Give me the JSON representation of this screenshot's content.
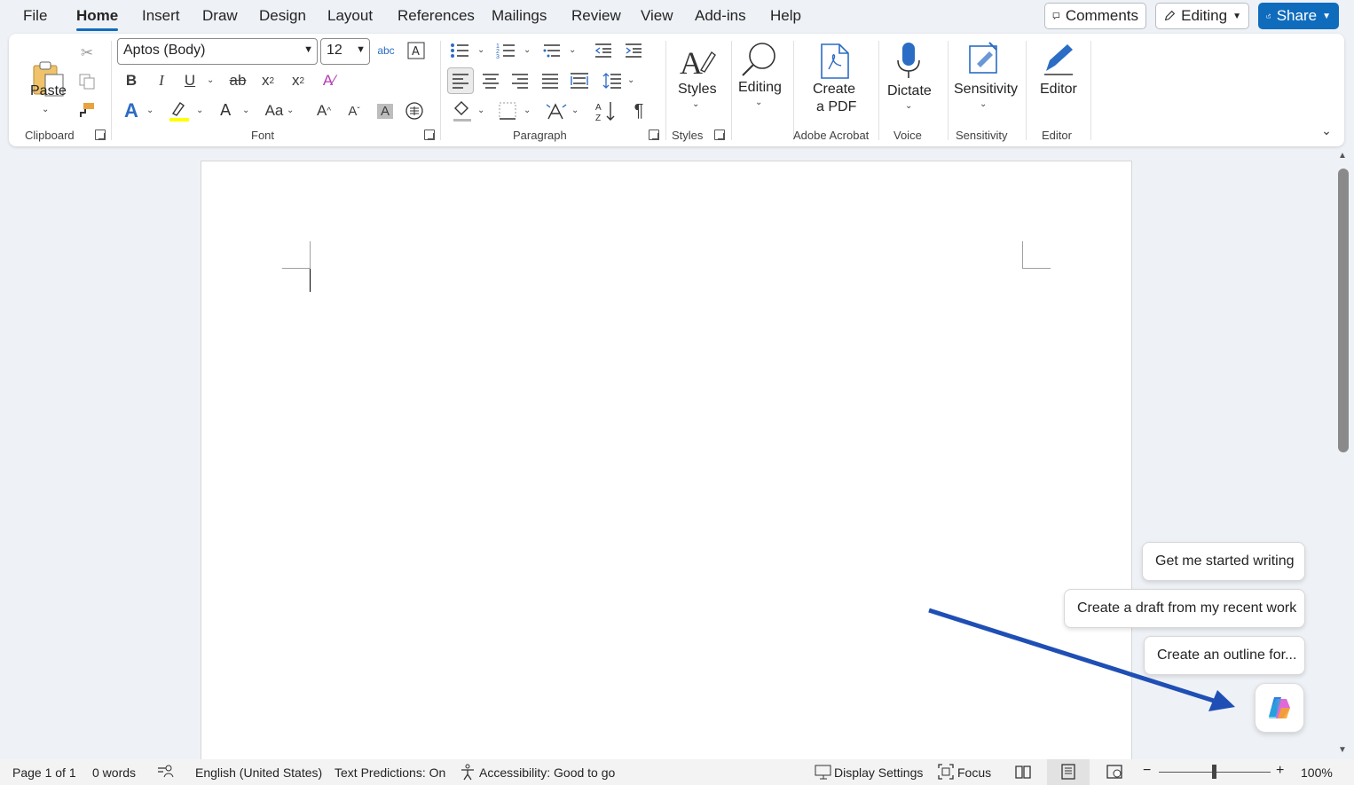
{
  "menu": {
    "tabs": [
      "File",
      "Home",
      "Insert",
      "Draw",
      "Design",
      "Layout",
      "References",
      "Mailings",
      "Review",
      "View",
      "Add-ins",
      "Help"
    ],
    "active_tab": "Home",
    "comments_label": "Comments",
    "editing_label": "Editing",
    "share_label": "Share"
  },
  "ribbon": {
    "clipboard": {
      "paste_label": "Paste",
      "group_label": "Clipboard"
    },
    "font": {
      "font_name": "Aptos (Body)",
      "font_size": "12",
      "group_label": "Font"
    },
    "paragraph": {
      "group_label": "Paragraph"
    },
    "styles": {
      "styles_label": "Styles",
      "group_label": "Styles"
    },
    "editing": {
      "label": "Editing"
    },
    "acrobat": {
      "label_line1": "Create",
      "label_line2": "a PDF",
      "group_label": "Adobe Acrobat"
    },
    "voice": {
      "label": "Dictate",
      "group_label": "Voice"
    },
    "sensitivity": {
      "label": "Sensitivity",
      "group_label": "Sensitivity"
    },
    "editor": {
      "label": "Editor",
      "group_label": "Editor"
    }
  },
  "copilot": {
    "suggestions": [
      "Get me started writing",
      "Create a draft from my recent work",
      "Create an outline for..."
    ]
  },
  "status": {
    "page": "Page 1 of 1",
    "words": "0 words",
    "language": "English (United States)",
    "predictions": "Text Predictions: On",
    "accessibility": "Accessibility: Good to go",
    "display_settings": "Display Settings",
    "focus": "Focus",
    "zoom": "100%"
  },
  "colors": {
    "accent": "#0f6cbd",
    "annotation_arrow": "#1f4fb5",
    "highlight": "#ffff00"
  }
}
